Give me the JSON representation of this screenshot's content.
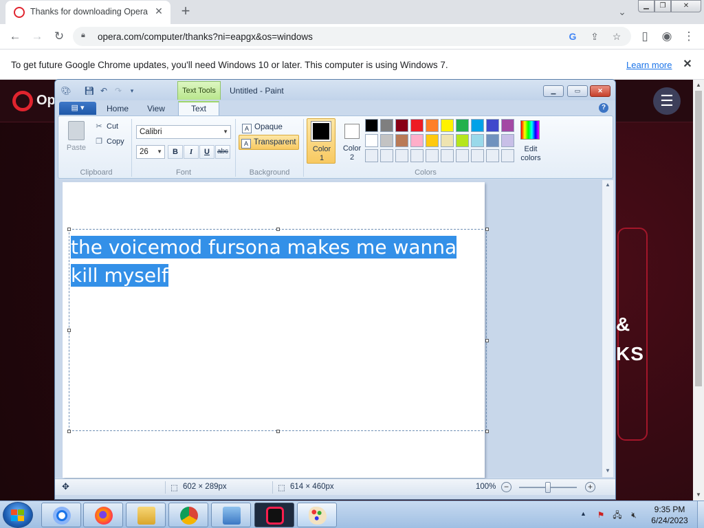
{
  "browser": {
    "tab_title": "Thanks for downloading Opera",
    "tab_close": "✕",
    "new_tab": "+",
    "url": "opera.com/computer/thanks?ni=eapgx&os=windows",
    "infobar_message": "To get future Google Chrome updates, you'll need Windows 10 or later. This computer is using Windows 7.",
    "infobar_link": "Learn more"
  },
  "opera_page": {
    "logo_text": "Op",
    "big_line_1": "&",
    "big_line_2": "KS"
  },
  "paint": {
    "window_title": "Untitled - Paint",
    "context_tab": "Text Tools",
    "tabs": [
      "Home",
      "View",
      "Text"
    ],
    "active_tab": "Text",
    "clipboard": {
      "paste": "Paste",
      "cut": "Cut",
      "copy": "Copy",
      "group_label": "Clipboard"
    },
    "font": {
      "name": "Calibri",
      "size": "26",
      "bold": "B",
      "italic": "I",
      "underline": "U",
      "strikethrough": "abc",
      "group_label": "Font"
    },
    "background": {
      "opaque": "Opaque",
      "transparent": "Transparent",
      "selected": "Transparent",
      "group_label": "Background"
    },
    "colors": {
      "color1_label_a": "Color",
      "color1_label_b": "1",
      "color2_label_a": "Color",
      "color2_label_b": "2",
      "color1": "#000000",
      "color2": "#ffffff",
      "edit_a": "Edit",
      "edit_b": "colors",
      "group_label": "Colors",
      "palette_row1": [
        "#000000",
        "#7f7f7f",
        "#880015",
        "#ed1c24",
        "#ff7f27",
        "#fff200",
        "#22b14c",
        "#00a2e8",
        "#3f48cc",
        "#a349a4"
      ],
      "palette_row2": [
        "#ffffff",
        "#c3c3c3",
        "#b97a57",
        "#ffaec9",
        "#ffc90e",
        "#efe4b0",
        "#b5e61d",
        "#99d9ea",
        "#7092be",
        "#c8bfe7"
      ],
      "palette_row3": [
        "#e8eef6",
        "#e8eef6",
        "#e8eef6",
        "#e8eef6",
        "#e8eef6",
        "#e8eef6",
        "#e8eef6",
        "#e8eef6",
        "#e8eef6",
        "#e8eef6"
      ]
    },
    "canvas_text_line1": "the voicemod fursona makes me wanna ",
    "canvas_text_line2": "kill myself",
    "status": {
      "selection_size": "602 × 289px",
      "canvas_size": "614 × 460px",
      "zoom": "100%",
      "zoom_fraction": 0.5
    }
  },
  "taskbar": {
    "time": "9:35 PM",
    "date": "6/24/2023"
  },
  "accent_colors": {
    "opera_red": "#e0242e",
    "selection_blue": "#3390e8",
    "chrome_link": "#1a73e8"
  }
}
